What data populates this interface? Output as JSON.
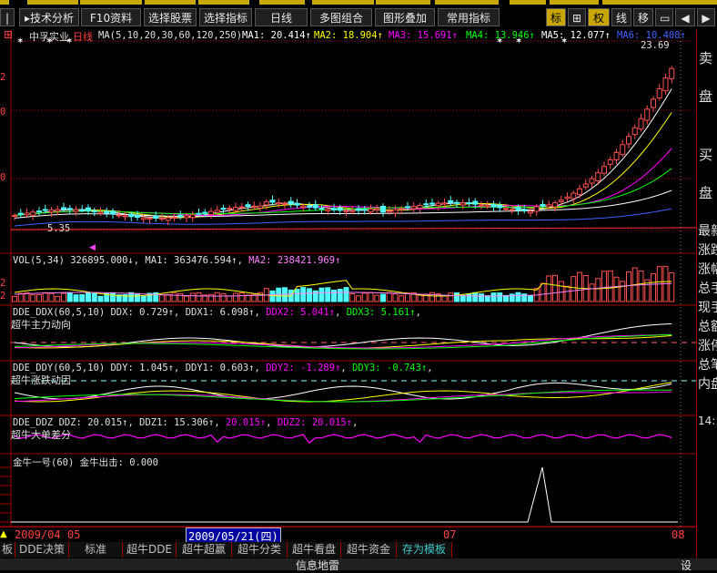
{
  "toolbar": {
    "buttons": [
      {
        "label": "技术分析",
        "arrow": "▸"
      },
      {
        "label": "F10资料"
      },
      {
        "label": "选择股票"
      },
      {
        "label": "选择指标"
      },
      {
        "label": "日线"
      },
      {
        "label": "多图组合"
      },
      {
        "label": "图形叠加"
      },
      {
        "label": "常用指标"
      }
    ],
    "small_buttons": [
      "标",
      "权",
      "线",
      "移"
    ],
    "accent": "#c8a800"
  },
  "main_chart": {
    "stock_name": "中孚实业",
    "period": "日线",
    "ma_params": "MA(5,10,20,30,60,120,250)",
    "ma_values": [
      {
        "label": "MA1:",
        "value": "20.414",
        "color": "#ffffff"
      },
      {
        "label": "MA2:",
        "value": "18.904",
        "color": "#ffff00"
      },
      {
        "label": "MA3:",
        "value": "15.691",
        "color": "#ff00ff"
      },
      {
        "label": "MA4:",
        "value": "13.946",
        "color": "#00ff00"
      },
      {
        "label": "MA5:",
        "value": "12.077",
        "color": "#ffffff"
      },
      {
        "label": "MA6:",
        "value": "10.408",
        "color": "#4060ff"
      }
    ],
    "high_label": "23.69",
    "low_label": "5.35",
    "y_ticks": [
      "2",
      "0",
      "0"
    ]
  },
  "volume": {
    "title": "VOL(5,34)",
    "vol": "326895.000",
    "ma1_label": "MA1:",
    "ma1": "363476.594",
    "ma2_label": "MA2:",
    "ma2": "238421.969",
    "y_ticks": [
      "2",
      "2"
    ]
  },
  "ddx": {
    "title": "DDE_DDX(60,5,10)",
    "ddx_label": "DDX:",
    "ddx": "0.729",
    "ddx1_label": "DDX1:",
    "ddx1": "6.098",
    "ddx2_label": "DDX2:",
    "ddx2": "5.041",
    "ddx3_label": "DDX3:",
    "ddx3": "5.161",
    "subtitle": "超牛主力动向"
  },
  "ddy": {
    "title": "DDE_DDY(60,5,10)",
    "ddy_label": "DDY:",
    "ddy": "1.045",
    "ddy1_label": "DDY1:",
    "ddy1": "0.603",
    "ddy2_label": "DDY2:",
    "ddy2": "-1.289",
    "ddy3_label": "DDY3:",
    "ddy3": "-0.743",
    "subtitle": "超牛涨跌动因"
  },
  "ddz": {
    "title": "DDE_DDZ",
    "ddz_label": "DDZ:",
    "ddz": "20.015",
    "ddz1_label": "DDZ1:",
    "ddz1": "15.306",
    "extra": "20.015",
    "ddz2_label": "DDZ2:",
    "ddz2": "20.015",
    "subtitle": "超牛大单差分"
  },
  "jinniu": {
    "title": "金牛一号(60)",
    "signal_label": "金牛出击:",
    "signal": "0.000"
  },
  "date_bar": {
    "left_date": "2009/04",
    "month1": "05",
    "cursor_date": "2009/05/21",
    "cursor_weekday": "四",
    "month2": "07",
    "month3": "08"
  },
  "tabs": [
    "板",
    "DDE决策",
    "标准",
    "超牛DDE",
    "超牛超赢",
    "超牛分类",
    "超牛看盘",
    "超牛资金",
    "存为模板"
  ],
  "active_tab": "存为模板",
  "right_panel": {
    "top": [
      "卖",
      "盘",
      "买",
      "盘"
    ],
    "rows": [
      "最新",
      "涨跌",
      "涨幅",
      "总手",
      "现手",
      "总额",
      "涨停",
      "总笔",
      "内盘"
    ],
    "time": "14:"
  },
  "status": {
    "center": "信息地雷",
    "right": "设"
  },
  "colors": {
    "up": "#ff5050",
    "down": "#50ffff",
    "grid": "#a00000",
    "ma_white": "#ffffff",
    "ma_yellow": "#ffff00",
    "ma_magenta": "#ff00ff",
    "ma_green": "#00ff00",
    "ma_blue": "#4060ff"
  }
}
